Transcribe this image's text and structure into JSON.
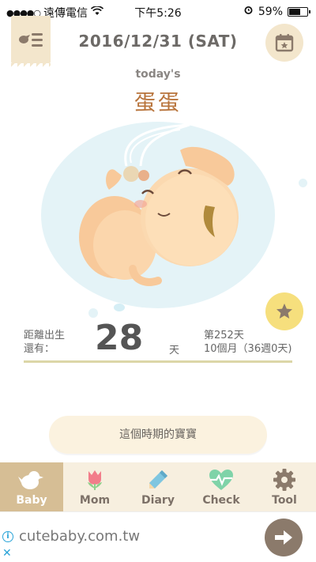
{
  "status_bar": {
    "signal": "●●●●○",
    "carrier": "遠傳電信",
    "time": "下午5:26",
    "battery": "59%",
    "battery_level": 0.59
  },
  "header": {
    "date": "2016/12/31 (SAT)",
    "today_label": "today's",
    "baby_name": "蛋蛋"
  },
  "countdown": {
    "label_line1": "距離出生",
    "label_line2": "還有：",
    "days_remaining": "28",
    "unit": "天",
    "week_day": "第252天",
    "month_week": "10個月（36週0天)"
  },
  "period_button": "這個時期的寶寶",
  "tabs": [
    {
      "label": "Baby",
      "icon": "bird-icon",
      "active": true
    },
    {
      "label": "Mom",
      "icon": "tulip-icon",
      "active": false
    },
    {
      "label": "Diary",
      "icon": "pencil-icon",
      "active": false
    },
    {
      "label": "Check",
      "icon": "heartbeat-icon",
      "active": false
    },
    {
      "label": "Tool",
      "icon": "gear-icon",
      "active": false
    }
  ],
  "ad": {
    "url": "cutebaby.com.tw",
    "info_glyph": "i",
    "close_glyph": "✕"
  },
  "colors": {
    "accent": "#d6be95",
    "tab_bg": "#f7efdf",
    "name": "#b8743c",
    "star": "#f6df7d"
  }
}
